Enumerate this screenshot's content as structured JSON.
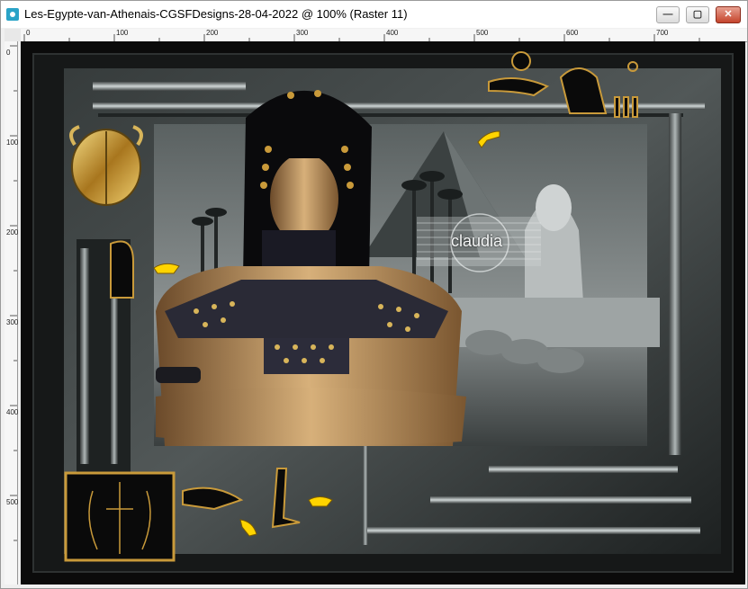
{
  "window": {
    "title": "Les-Egypte-van-Athenais-CGSFDesigns-28-04-2022 @ 100% (Raster 11)"
  },
  "window_controls": {
    "minimize_icon": "minimize-icon",
    "maximize_icon": "maximize-icon",
    "close_icon": "close-icon"
  },
  "rulers": {
    "top_labels": [
      "0",
      "100",
      "200",
      "300",
      "400",
      "500",
      "600",
      "700"
    ],
    "left_labels": [
      "0",
      "100",
      "200",
      "300",
      "400",
      "500"
    ]
  },
  "canvas": {
    "watermark_text": "claudia",
    "colors": {
      "background": "#0c0c0c",
      "gold": "#c99a3a",
      "silver": "#9aa3a3",
      "pointer_yellow": "#ffd400"
    }
  }
}
